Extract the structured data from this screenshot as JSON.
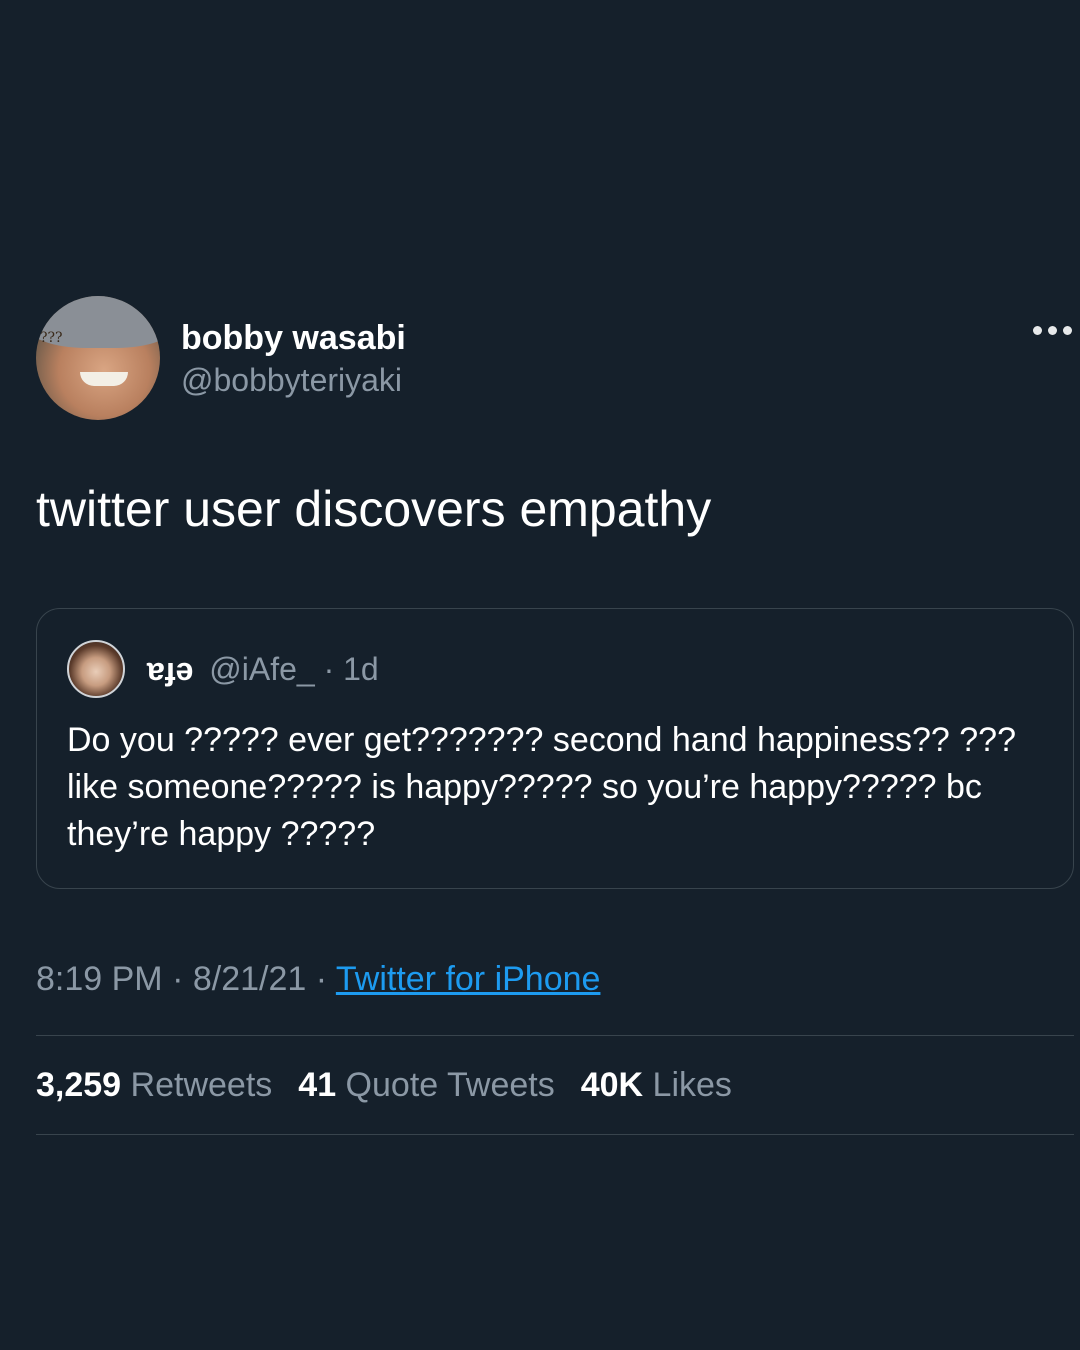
{
  "tweet": {
    "display_name": "bobby wasabi",
    "handle": "@bobbyteriyaki",
    "avatar_overlay_text": "???",
    "text": "twitter user discovers empathy",
    "timestamp": "8:19 PM · 8/21/21 · ",
    "source": "Twitter for iPhone"
  },
  "quote": {
    "display_name": "ɐɟǝ",
    "meta": "@iAfe_ · 1d",
    "text": "Do you ????? ever get??????? second hand happiness?? ??? like someone????? is happy????? so you’re happy????? bc they’re happy ?????"
  },
  "stats": {
    "retweets_count": "3,259",
    "retweets_label": " Retweets",
    "quotes_count": "41",
    "quotes_label": " Quote Tweets",
    "likes_count": "40K",
    "likes_label": " Likes"
  },
  "colors": {
    "background": "#15202b",
    "link": "#1d9bf0",
    "secondary_text": "#8b98a5"
  }
}
